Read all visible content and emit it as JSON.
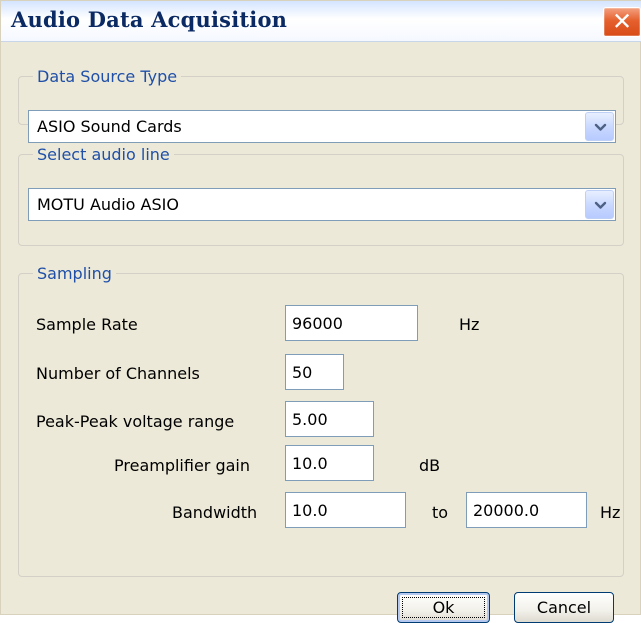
{
  "window": {
    "title": "Audio Data Acquisition",
    "close_glyph": "✕"
  },
  "data_source": {
    "legend": "Data Source Type",
    "selected": "ASIO Sound Cards"
  },
  "audio_line": {
    "legend": "Select audio line",
    "selected": "MOTU Audio ASIO"
  },
  "sampling": {
    "legend": "Sampling",
    "sample_rate": {
      "label": "Sample Rate",
      "value": "96000",
      "unit": "Hz"
    },
    "channels": {
      "label": "Number of Channels",
      "value": "50"
    },
    "voltage_range": {
      "label": "Peak-Peak voltage range",
      "value": "5.00"
    },
    "preamp_gain": {
      "label": "Preamplifier gain",
      "value": "10.0",
      "unit": "dB"
    },
    "bandwidth": {
      "label": "Bandwidth",
      "from": "10.0",
      "to_label": "to",
      "to": "20000.0",
      "unit": "Hz"
    }
  },
  "buttons": {
    "ok": "Ok",
    "cancel": "Cancel"
  },
  "colors": {
    "legend_text": "#1f4fa8",
    "title_text": "#0b2a63",
    "close_button": "#e5602d"
  }
}
